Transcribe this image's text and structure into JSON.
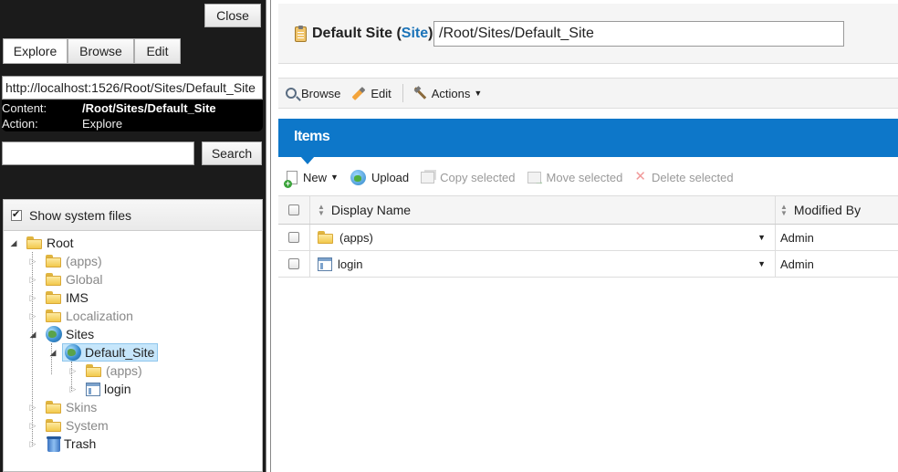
{
  "left": {
    "close_label": "Close",
    "tabs": [
      {
        "label": "Explore"
      },
      {
        "label": "Browse"
      },
      {
        "label": "Edit"
      }
    ],
    "url": "http://localhost:1526/Root/Sites/Default_Site",
    "content_label": "Content:",
    "content_value": "/Root/Sites/Default_Site",
    "action_label": "Action:",
    "action_value": "Explore",
    "search_placeholder": "",
    "search_label": "Search",
    "show_system_files": "Show system files",
    "tree": {
      "root": "Root",
      "apps": "(apps)",
      "global": "Global",
      "ims": "IMS",
      "localization": "Localization",
      "sites": "Sites",
      "default_site": "Default_Site",
      "site_apps": "(apps)",
      "login": "login",
      "skins": "Skins",
      "system": "System",
      "trash": "Trash"
    }
  },
  "header": {
    "title": "Default Site",
    "type_open": "(",
    "type": "Site",
    "type_close": ")",
    "path": "/Root/Sites/Default_Site"
  },
  "toolbar": {
    "browse": "Browse",
    "edit": "Edit",
    "actions": "Actions"
  },
  "items": {
    "title": "Items",
    "toolbar": {
      "new": "New",
      "upload": "Upload",
      "copy_selected": "Copy selected",
      "move_selected": "Move selected",
      "delete_selected": "Delete selected"
    },
    "columns": {
      "display_name": "Display Name",
      "modified_by": "Modified By"
    },
    "rows": [
      {
        "name": "(apps)",
        "modified_by": "Admin"
      },
      {
        "name": "login",
        "modified_by": "Admin"
      }
    ]
  },
  "colors": {
    "accent_blue": "#0d77c9",
    "left_background": "#1b1b1b",
    "selected_node": "#c6e6fb"
  }
}
